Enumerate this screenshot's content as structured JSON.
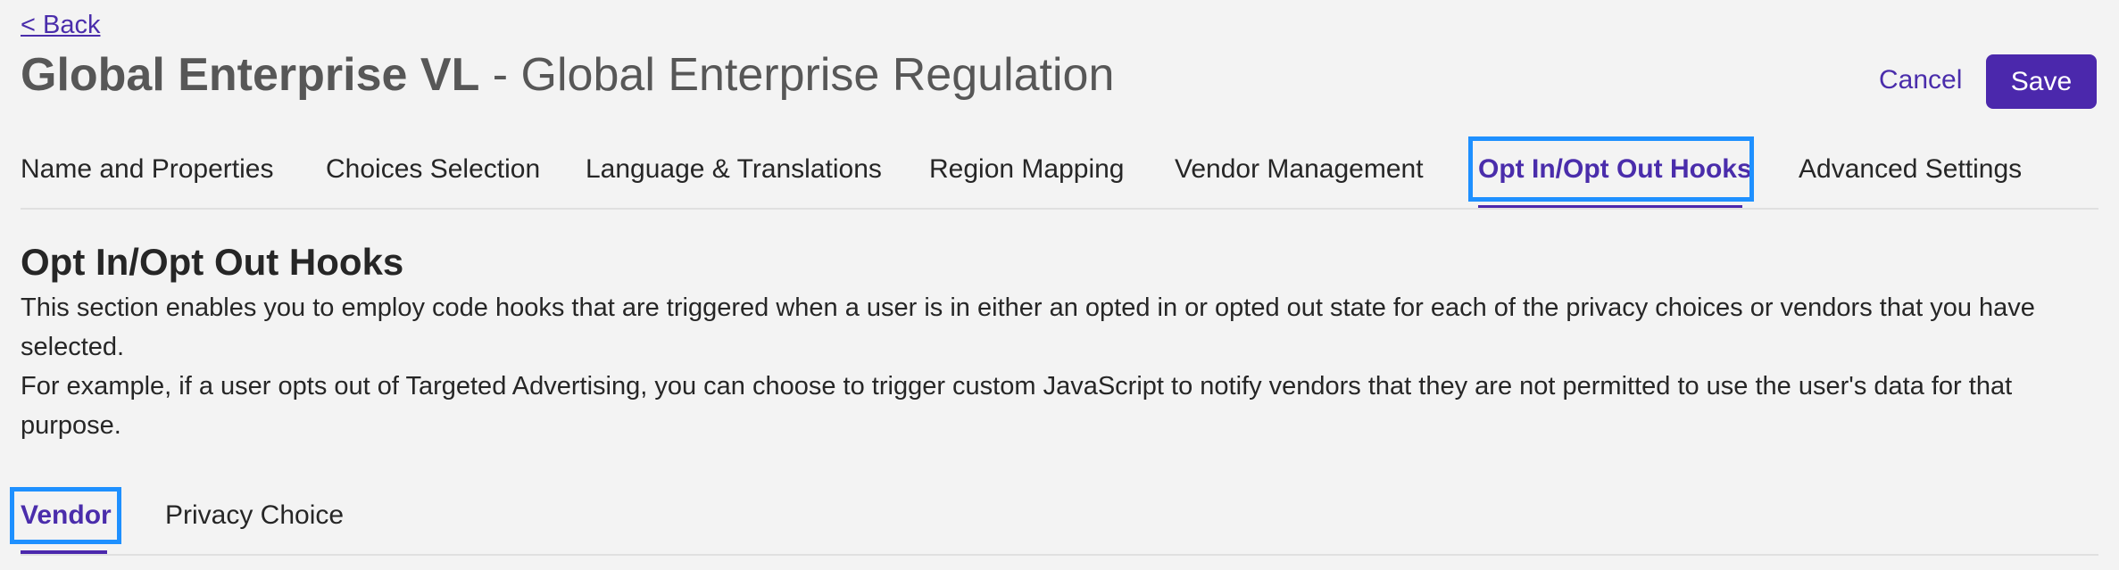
{
  "header": {
    "back_label": "< Back",
    "title_bold": "Global Enterprise VL",
    "title_rest": " - Global Enterprise Regulation",
    "cancel_label": "Cancel",
    "save_label": "Save"
  },
  "tabs": [
    {
      "label": "Name and Properties",
      "active": false
    },
    {
      "label": "Choices Selection",
      "active": false
    },
    {
      "label": "Language & Translations",
      "active": false
    },
    {
      "label": "Region Mapping",
      "active": false
    },
    {
      "label": "Vendor Management",
      "active": false
    },
    {
      "label": "Opt In/Opt Out Hooks",
      "active": true
    },
    {
      "label": "Advanced Settings",
      "active": false
    }
  ],
  "section": {
    "title": "Opt In/Opt Out Hooks",
    "paragraph1": "This section enables you to employ code hooks that are triggered when a user is in either an opted in or opted out state for each of the privacy choices or vendors that you have selected.",
    "paragraph2": "For example, if a user opts out of Targeted Advertising, you can choose to trigger custom JavaScript to notify vendors that they are not permitted to use the user's data for that purpose."
  },
  "sub_tabs": [
    {
      "label": "Vendor",
      "active": true
    },
    {
      "label": "Privacy Choice",
      "active": false
    }
  ],
  "colors": {
    "accent": "#4b28ac",
    "focus_outline": "#1e90ff",
    "background": "#f3f3f3"
  }
}
